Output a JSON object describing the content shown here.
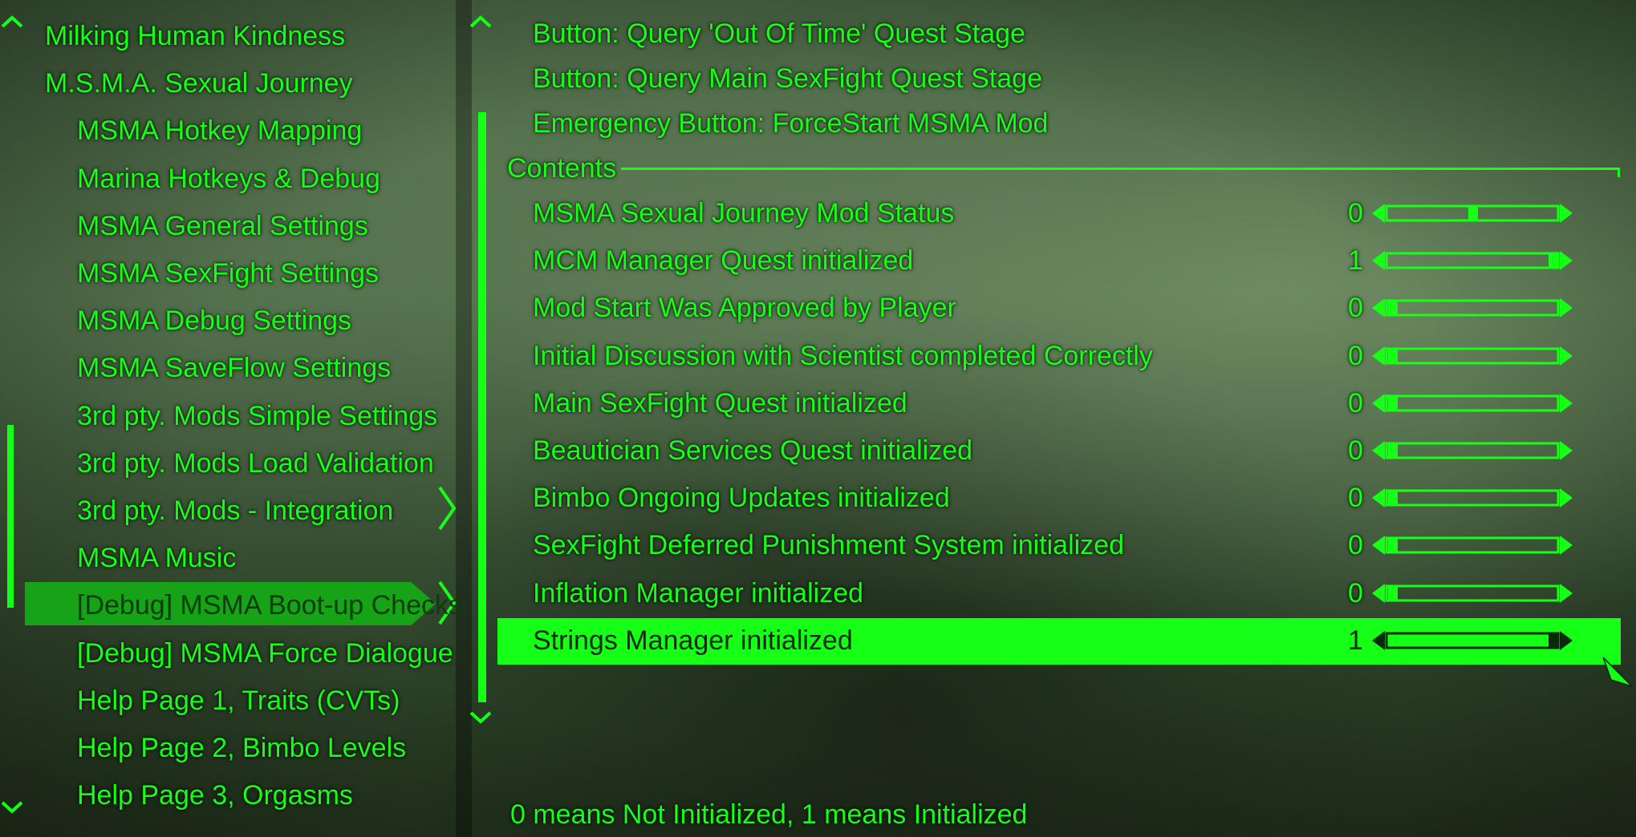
{
  "left_menu": {
    "items": [
      {
        "label": "Milking Human Kindness",
        "level": 0
      },
      {
        "label": "M.S.M.A. Sexual Journey",
        "level": 0
      },
      {
        "label": "MSMA Hotkey Mapping",
        "level": 1
      },
      {
        "label": "Marina Hotkeys & Debug",
        "level": 1
      },
      {
        "label": "MSMA General Settings",
        "level": 1
      },
      {
        "label": "MSMA SexFight Settings",
        "level": 1
      },
      {
        "label": "MSMA Debug Settings",
        "level": 1
      },
      {
        "label": "MSMA SaveFlow Settings",
        "level": 1
      },
      {
        "label": "3rd pty. Mods Simple Settings",
        "level": 1
      },
      {
        "label": "3rd pty. Mods Load Validation",
        "level": 1
      },
      {
        "label": "3rd pty. Mods - Integration",
        "level": 1
      },
      {
        "label": "MSMA Music",
        "level": 1
      },
      {
        "label": "[Debug] MSMA Boot-up Checks",
        "level": 1,
        "selected": true
      },
      {
        "label": "[Debug] MSMA Force Dialogue",
        "level": 1
      },
      {
        "label": "Help Page 1, Traits (CVTs)",
        "level": 1
      },
      {
        "label": "Help Page 2, Bimbo Levels",
        "level": 1
      },
      {
        "label": "Help Page 3, Orgasms",
        "level": 1
      }
    ]
  },
  "right_panel": {
    "buttons": [
      {
        "label": "Button: Query 'Out Of Time' Quest Stage"
      },
      {
        "label": "Button: Query Main SexFight Quest Stage"
      },
      {
        "label": "Emergency Button: ForceStart MSMA Mod"
      }
    ],
    "section_title": "Contents",
    "stats": [
      {
        "label": "MSMA Sexual Journey Mod Status",
        "value": "0",
        "level": 0.5
      },
      {
        "label": "MCM Manager Quest initialized",
        "value": "1",
        "level": 1
      },
      {
        "label": "Mod Start Was Approved by Player",
        "value": "0",
        "level": 0
      },
      {
        "label": "Initial Discussion with Scientist completed Correctly",
        "value": "0",
        "level": 0
      },
      {
        "label": "Main SexFight Quest initialized",
        "value": "0",
        "level": 0
      },
      {
        "label": "Beautician Services Quest initialized",
        "value": "0",
        "level": 0
      },
      {
        "label": "Bimbo Ongoing Updates initialized",
        "value": "0",
        "level": 0
      },
      {
        "label": "SexFight Deferred Punishment System initialized",
        "value": "0",
        "level": 0
      },
      {
        "label": "Inflation Manager initialized",
        "value": "0",
        "level": 0
      },
      {
        "label": "Strings Manager initialized",
        "value": "1",
        "level": 1,
        "selected": true
      }
    ],
    "footer": "0 means Not Initialized, 1 means Initialized"
  },
  "colors": {
    "accent": "#16ff16",
    "accent_dark": "#17a317",
    "selected_text": "#0b2a0b"
  }
}
